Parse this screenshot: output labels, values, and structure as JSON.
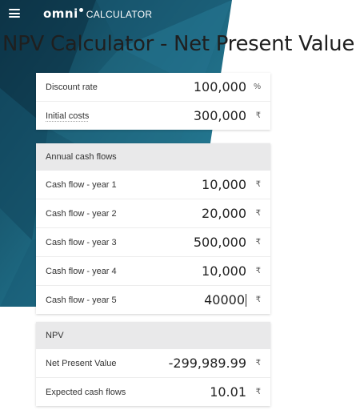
{
  "app": {
    "logo_brand": "omni",
    "logo_sub": "CALCULATOR",
    "title": "NPV Calculator - Net Present Value"
  },
  "colors": {
    "banner_dark": "#0e3a4e",
    "banner_mid": "#1f6c85",
    "banner_light": "#2c8aa3",
    "header_bg": "#e9e9ea"
  },
  "inputs_card": {
    "rows": [
      {
        "label": "Discount rate",
        "value": "100,000",
        "unit": "%"
      },
      {
        "label": "Initial costs",
        "value": "300,000",
        "unit": "₹"
      }
    ]
  },
  "cashflows_card": {
    "header": "Annual cash flows",
    "rows": [
      {
        "label": "Cash flow - year 1",
        "value": "10,000",
        "unit": "₹"
      },
      {
        "label": "Cash flow - year 2",
        "value": "20,000",
        "unit": "₹"
      },
      {
        "label": "Cash flow - year 3",
        "value": "500,000",
        "unit": "₹"
      },
      {
        "label": "Cash flow - year 4",
        "value": "10,000",
        "unit": "₹"
      },
      {
        "label": "Cash flow - year 5",
        "value": "40000",
        "unit": "₹"
      }
    ]
  },
  "npv_card": {
    "header": "NPV",
    "rows": [
      {
        "label": "Net Present Value",
        "value": "-299,989.99",
        "unit": "₹"
      },
      {
        "label": "Expected cash flows",
        "value": "10.01",
        "unit": "₹"
      }
    ]
  }
}
